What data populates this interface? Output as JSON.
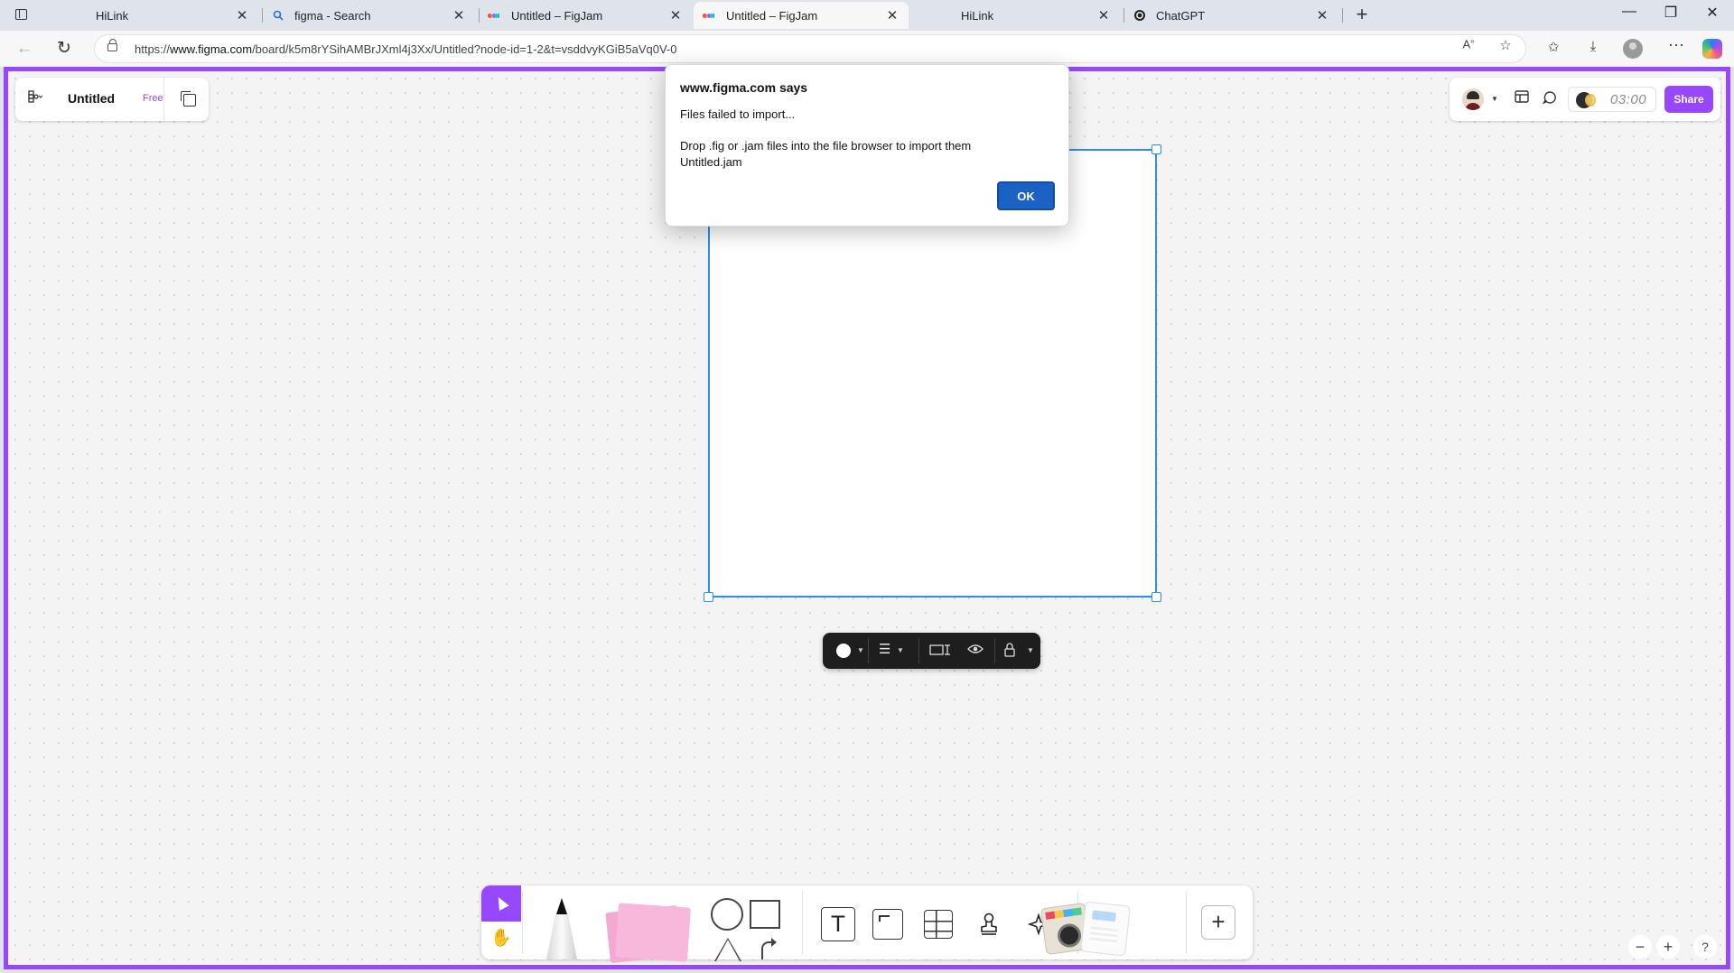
{
  "browser": {
    "tabs": [
      {
        "title": "HiLink",
        "icon": "blank-page-icon",
        "active": false
      },
      {
        "title": "figma - Search",
        "icon": "search-icon",
        "active": false
      },
      {
        "title": "Untitled – FigJam",
        "icon": "figma-icon",
        "active": false
      },
      {
        "title": "Untitled – FigJam",
        "icon": "figma-icon",
        "active": true
      },
      {
        "title": "HiLink",
        "icon": "blank-page-icon",
        "active": false
      },
      {
        "title": "ChatGPT",
        "icon": "chatgpt-icon",
        "active": false
      }
    ],
    "url_prefix": "https://",
    "url_domain": "www.figma.com",
    "url_path": "/board/k5m8rYSihAMBrJXml4j3Xx/Untitled?node-id=1-2&t=vsddvyKGiB5aVq0V-0"
  },
  "figjam": {
    "file_name": "Untitled",
    "plan_badge": "Free",
    "timer": "03:00",
    "share_label": "Share",
    "accent_color": "#9747ff",
    "selection_color": "#2f8cf0"
  },
  "dialog": {
    "title": "www.figma.com says",
    "message": "Files failed to import...",
    "detail_line1": "Drop .fig or .jam files into the file browser to import them",
    "detail_line2": "Untitled.jam",
    "ok_label": "OK"
  },
  "zoom_controls": {
    "minus": "−",
    "plus": "+",
    "help": "?"
  }
}
